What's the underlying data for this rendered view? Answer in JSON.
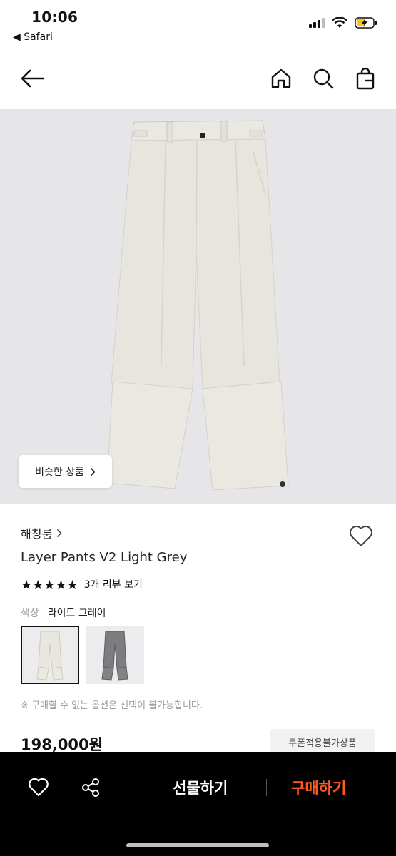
{
  "status_bar": {
    "time": "10:06",
    "back_app": "◀ Safari"
  },
  "nav": {
    "back_icon": "back-arrow-icon",
    "home_icon": "home-icon",
    "search_icon": "search-icon",
    "bag_icon": "shopping-bag-icon"
  },
  "image": {
    "similar_label": "비슷한 상품"
  },
  "product": {
    "brand": "해칭룸",
    "title": "Layer Pants V2 Light Grey",
    "stars": "★★★★★",
    "review_link": "3개 리뷰 보기",
    "color_label": "색상",
    "color_value": "라이트 그레이",
    "notice": "※ 구매할 수 없는 옵션은 선택이 불가능합니다.",
    "price": "198,000원",
    "coupon_badge": "쿠폰적용불가상품"
  },
  "bottom_bar": {
    "gift_label": "선물하기",
    "buy_label": "구매하기"
  },
  "colors": {
    "accent": "#ff5a1f",
    "image_bg": "#e6e6e8",
    "pants_light": "#e9e6df",
    "pants_dark": "#7d7d7f"
  }
}
